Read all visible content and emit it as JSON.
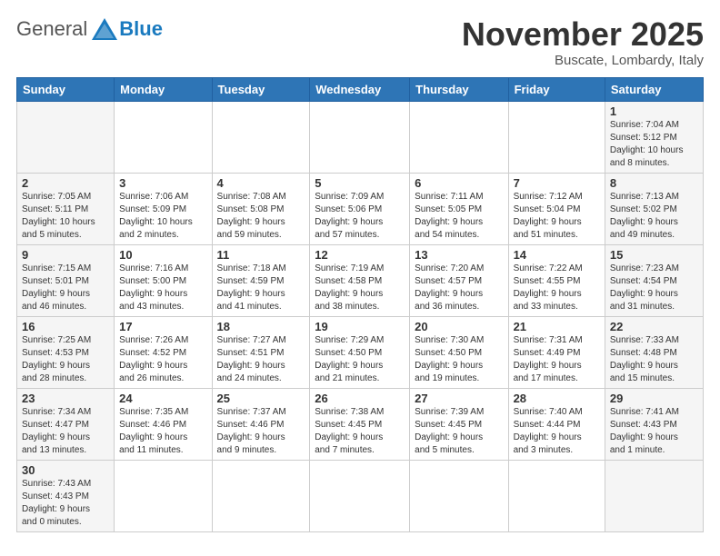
{
  "header": {
    "logo_general": "General",
    "logo_blue": "Blue",
    "month_title": "November 2025",
    "location": "Buscate, Lombardy, Italy"
  },
  "days_of_week": [
    "Sunday",
    "Monday",
    "Tuesday",
    "Wednesday",
    "Thursday",
    "Friday",
    "Saturday"
  ],
  "weeks": [
    {
      "days": [
        {
          "number": "",
          "info": ""
        },
        {
          "number": "",
          "info": ""
        },
        {
          "number": "",
          "info": ""
        },
        {
          "number": "",
          "info": ""
        },
        {
          "number": "",
          "info": ""
        },
        {
          "number": "",
          "info": ""
        },
        {
          "number": "1",
          "info": "Sunrise: 7:04 AM\nSunset: 5:12 PM\nDaylight: 10 hours\nand 8 minutes."
        }
      ]
    },
    {
      "days": [
        {
          "number": "2",
          "info": "Sunrise: 7:05 AM\nSunset: 5:11 PM\nDaylight: 10 hours\nand 5 minutes."
        },
        {
          "number": "3",
          "info": "Sunrise: 7:06 AM\nSunset: 5:09 PM\nDaylight: 10 hours\nand 2 minutes."
        },
        {
          "number": "4",
          "info": "Sunrise: 7:08 AM\nSunset: 5:08 PM\nDaylight: 9 hours\nand 59 minutes."
        },
        {
          "number": "5",
          "info": "Sunrise: 7:09 AM\nSunset: 5:06 PM\nDaylight: 9 hours\nand 57 minutes."
        },
        {
          "number": "6",
          "info": "Sunrise: 7:11 AM\nSunset: 5:05 PM\nDaylight: 9 hours\nand 54 minutes."
        },
        {
          "number": "7",
          "info": "Sunrise: 7:12 AM\nSunset: 5:04 PM\nDaylight: 9 hours\nand 51 minutes."
        },
        {
          "number": "8",
          "info": "Sunrise: 7:13 AM\nSunset: 5:02 PM\nDaylight: 9 hours\nand 49 minutes."
        }
      ]
    },
    {
      "days": [
        {
          "number": "9",
          "info": "Sunrise: 7:15 AM\nSunset: 5:01 PM\nDaylight: 9 hours\nand 46 minutes."
        },
        {
          "number": "10",
          "info": "Sunrise: 7:16 AM\nSunset: 5:00 PM\nDaylight: 9 hours\nand 43 minutes."
        },
        {
          "number": "11",
          "info": "Sunrise: 7:18 AM\nSunset: 4:59 PM\nDaylight: 9 hours\nand 41 minutes."
        },
        {
          "number": "12",
          "info": "Sunrise: 7:19 AM\nSunset: 4:58 PM\nDaylight: 9 hours\nand 38 minutes."
        },
        {
          "number": "13",
          "info": "Sunrise: 7:20 AM\nSunset: 4:57 PM\nDaylight: 9 hours\nand 36 minutes."
        },
        {
          "number": "14",
          "info": "Sunrise: 7:22 AM\nSunset: 4:55 PM\nDaylight: 9 hours\nand 33 minutes."
        },
        {
          "number": "15",
          "info": "Sunrise: 7:23 AM\nSunset: 4:54 PM\nDaylight: 9 hours\nand 31 minutes."
        }
      ]
    },
    {
      "days": [
        {
          "number": "16",
          "info": "Sunrise: 7:25 AM\nSunset: 4:53 PM\nDaylight: 9 hours\nand 28 minutes."
        },
        {
          "number": "17",
          "info": "Sunrise: 7:26 AM\nSunset: 4:52 PM\nDaylight: 9 hours\nand 26 minutes."
        },
        {
          "number": "18",
          "info": "Sunrise: 7:27 AM\nSunset: 4:51 PM\nDaylight: 9 hours\nand 24 minutes."
        },
        {
          "number": "19",
          "info": "Sunrise: 7:29 AM\nSunset: 4:50 PM\nDaylight: 9 hours\nand 21 minutes."
        },
        {
          "number": "20",
          "info": "Sunrise: 7:30 AM\nSunset: 4:50 PM\nDaylight: 9 hours\nand 19 minutes."
        },
        {
          "number": "21",
          "info": "Sunrise: 7:31 AM\nSunset: 4:49 PM\nDaylight: 9 hours\nand 17 minutes."
        },
        {
          "number": "22",
          "info": "Sunrise: 7:33 AM\nSunset: 4:48 PM\nDaylight: 9 hours\nand 15 minutes."
        }
      ]
    },
    {
      "days": [
        {
          "number": "23",
          "info": "Sunrise: 7:34 AM\nSunset: 4:47 PM\nDaylight: 9 hours\nand 13 minutes."
        },
        {
          "number": "24",
          "info": "Sunrise: 7:35 AM\nSunset: 4:46 PM\nDaylight: 9 hours\nand 11 minutes."
        },
        {
          "number": "25",
          "info": "Sunrise: 7:37 AM\nSunset: 4:46 PM\nDaylight: 9 hours\nand 9 minutes."
        },
        {
          "number": "26",
          "info": "Sunrise: 7:38 AM\nSunset: 4:45 PM\nDaylight: 9 hours\nand 7 minutes."
        },
        {
          "number": "27",
          "info": "Sunrise: 7:39 AM\nSunset: 4:45 PM\nDaylight: 9 hours\nand 5 minutes."
        },
        {
          "number": "28",
          "info": "Sunrise: 7:40 AM\nSunset: 4:44 PM\nDaylight: 9 hours\nand 3 minutes."
        },
        {
          "number": "29",
          "info": "Sunrise: 7:41 AM\nSunset: 4:43 PM\nDaylight: 9 hours\nand 1 minute."
        }
      ]
    },
    {
      "days": [
        {
          "number": "30",
          "info": "Sunrise: 7:43 AM\nSunset: 4:43 PM\nDaylight: 9 hours\nand 0 minutes."
        },
        {
          "number": "",
          "info": ""
        },
        {
          "number": "",
          "info": ""
        },
        {
          "number": "",
          "info": ""
        },
        {
          "number": "",
          "info": ""
        },
        {
          "number": "",
          "info": ""
        },
        {
          "number": "",
          "info": ""
        }
      ]
    }
  ]
}
